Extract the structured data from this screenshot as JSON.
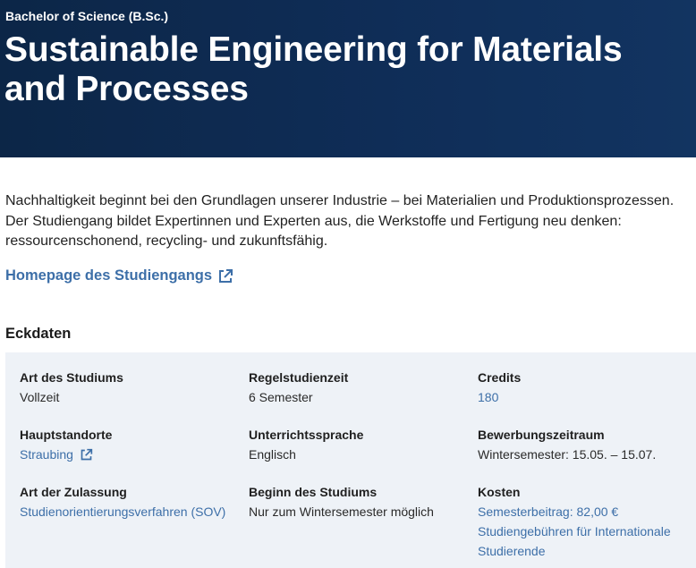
{
  "hero": {
    "degree": "Bachelor of Science (B.Sc.)",
    "title": "Sustainable Engineering for Materials and Processes"
  },
  "intro": "Nachhaltigkeit beginnt bei den Grundlagen unserer Industrie – bei Materialien und Produktionsprozessen. Der Studiengang bildet Expertinnen und Experten aus, die Werkstoffe und Fertigung neu denken: ressourcenschonend, recycling- und zukunftsfähig.",
  "homepage_link": "Homepage des Studiengangs",
  "facts": {
    "title": "Eckdaten",
    "art_des_studiums": {
      "label": "Art des Studiums",
      "value": "Vollzeit"
    },
    "regelstudienzeit": {
      "label": "Regelstudienzeit",
      "value": "6 Semester"
    },
    "credits": {
      "label": "Credits",
      "value": "180"
    },
    "hauptstandorte": {
      "label": "Hauptstandorte",
      "value": "Straubing"
    },
    "unterrichtssprache": {
      "label": "Unterrichtssprache",
      "value": "Englisch"
    },
    "bewerbungszeitraum": {
      "label": "Bewerbungszeitraum",
      "value": "Wintersemester: 15.05. – 15.07."
    },
    "art_der_zulassung": {
      "label": "Art der Zulassung",
      "value": "Studienorientierungsverfahren (SOV)"
    },
    "beginn": {
      "label": "Beginn des Studiums",
      "value": "Nur zum Wintersemester möglich"
    },
    "kosten": {
      "label": "Kosten",
      "semesterbeitrag": "Semesterbeitrag: 82,00 €",
      "studiengebuehren": "Studiengebühren für Internationale Studierende"
    }
  },
  "colors": {
    "hero_bg": "#0f2d57",
    "link": "#3d6fa8",
    "facts_bg": "#eef2f7"
  },
  "icons": {
    "external_link": "external-link-icon"
  }
}
